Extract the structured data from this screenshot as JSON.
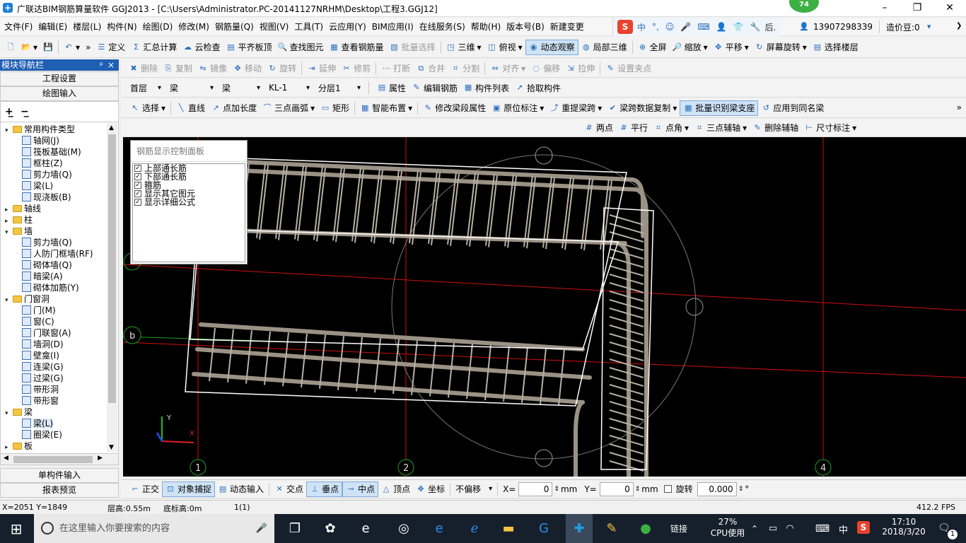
{
  "title_bar": {
    "title": "广联达BIM钢筋算量软件 GGJ2013 - [C:\\Users\\Administrator.PC-20141127NRHM\\Desktop\\工程3.GGJ12]",
    "badge": "74",
    "min": "–",
    "restore": "❐",
    "close": "✕"
  },
  "menu": {
    "items": [
      "文件(F)",
      "编辑(E)",
      "楼层(L)",
      "构件(N)",
      "绘图(D)",
      "修改(M)",
      "钢筋量(Q)",
      "视图(V)",
      "工具(T)",
      "云应用(Y)",
      "BIM应用(I)",
      "在线服务(S)",
      "帮助(H)",
      "版本号(B)",
      "新建变更"
    ],
    "ime": [
      "中",
      "°,",
      "☺",
      "🎤",
      "⌨",
      "👤",
      "👕",
      "🔧"
    ],
    "phone": "13907298339",
    "price": "造价豆:0"
  },
  "toolbar1": {
    "items": [
      "定义",
      "汇总计算",
      "云检查",
      "平齐板顶",
      "查找图元",
      "查看钢筋量",
      "批量选择",
      "三维",
      "俯视",
      "动态观察",
      "局部三维",
      "全屏",
      "缩放",
      "平移",
      "屏幕旋转",
      "选择楼层"
    ]
  },
  "toolbar2": {
    "items": [
      "删除",
      "复制",
      "镜像",
      "移动",
      "旋转",
      "延伸",
      "修剪",
      "打断",
      "合并",
      "分割",
      "对齐",
      "偏移",
      "拉伸",
      "设置夹点"
    ]
  },
  "toolbar3": {
    "floor": "首层",
    "type1": "梁",
    "type2": "梁",
    "comp": "KL-1",
    "layer": "分层1",
    "items": [
      "属性",
      "编辑钢筋",
      "构件列表",
      "拾取构件"
    ]
  },
  "toolbar4": {
    "items": [
      "选择",
      "直线",
      "点加长度",
      "三点画弧",
      "矩形",
      "智能布置",
      "修改梁段属性",
      "原位标注",
      "重提梁跨",
      "梁跨数据复制",
      "批量识别梁支座",
      "应用到同名梁"
    ]
  },
  "toolbar5": {
    "items": [
      "两点",
      "平行",
      "点角",
      "三点辅轴",
      "删除辅轴",
      "尺寸标注"
    ]
  },
  "nav": {
    "title": "模块导航栏",
    "pin": "ᵖ",
    "close": "×",
    "btn_project": "工程设置",
    "btn_draw": "绘图输入",
    "btn_single": "单构件输入",
    "btn_report": "报表预览",
    "tree": [
      {
        "label": "常用构件类型",
        "level": 0,
        "exp": "▾",
        "kind": "folder"
      },
      {
        "label": "轴网(J)",
        "level": 1,
        "kind": "item"
      },
      {
        "label": "筏板基础(M)",
        "level": 1,
        "kind": "item"
      },
      {
        "label": "框柱(Z)",
        "level": 1,
        "kind": "item"
      },
      {
        "label": "剪力墙(Q)",
        "level": 1,
        "kind": "item"
      },
      {
        "label": "梁(L)",
        "level": 1,
        "kind": "item"
      },
      {
        "label": "现浇板(B)",
        "level": 1,
        "kind": "item"
      },
      {
        "label": "轴线",
        "level": 0,
        "exp": "▸",
        "kind": "folder"
      },
      {
        "label": "柱",
        "level": 0,
        "exp": "▸",
        "kind": "folder"
      },
      {
        "label": "墙",
        "level": 0,
        "exp": "▾",
        "kind": "folder"
      },
      {
        "label": "剪力墙(Q)",
        "level": 1,
        "kind": "item"
      },
      {
        "label": "人防门框墙(RF)",
        "level": 1,
        "kind": "item"
      },
      {
        "label": "砌体墙(Q)",
        "level": 1,
        "kind": "item"
      },
      {
        "label": "暗梁(A)",
        "level": 1,
        "kind": "item"
      },
      {
        "label": "砌体加筋(Y)",
        "level": 1,
        "kind": "item"
      },
      {
        "label": "门窗洞",
        "level": 0,
        "exp": "▾",
        "kind": "folder"
      },
      {
        "label": "门(M)",
        "level": 1,
        "kind": "item"
      },
      {
        "label": "窗(C)",
        "level": 1,
        "kind": "item"
      },
      {
        "label": "门联窗(A)",
        "level": 1,
        "kind": "item"
      },
      {
        "label": "墙洞(D)",
        "level": 1,
        "kind": "item"
      },
      {
        "label": "壁龛(I)",
        "level": 1,
        "kind": "item"
      },
      {
        "label": "连梁(G)",
        "level": 1,
        "kind": "item"
      },
      {
        "label": "过梁(G)",
        "level": 1,
        "kind": "item"
      },
      {
        "label": "带形洞",
        "level": 1,
        "kind": "item"
      },
      {
        "label": "带形窗",
        "level": 1,
        "kind": "item"
      },
      {
        "label": "梁",
        "level": 0,
        "exp": "▾",
        "kind": "folder"
      },
      {
        "label": "梁(L)",
        "level": 1,
        "kind": "item",
        "selected": true
      },
      {
        "label": "圈梁(E)",
        "level": 1,
        "kind": "item"
      },
      {
        "label": "板",
        "level": 0,
        "exp": "▸",
        "kind": "folder"
      }
    ]
  },
  "panel": {
    "title": "钢筋显示控制面板",
    "options": [
      "上部通长筋",
      "下部通长筋",
      "箍筋",
      "显示其它图元",
      "显示详细公式"
    ]
  },
  "viewport": {
    "axes": [
      "1",
      "2",
      "4"
    ],
    "axis_b": "b",
    "axis_x": "X",
    "axis_y": "Y"
  },
  "snapbar": {
    "items": [
      "正交",
      "对象捕捉",
      "动态输入",
      "交点",
      "垂点",
      "中点",
      "顶点",
      "坐标"
    ],
    "offset": "不偏移",
    "x_label": "X=",
    "x_value": "0",
    "y_label": "Y=",
    "y_value": "0",
    "unit": "mm",
    "rotate_label": "旋转",
    "rotate_value": "0.000",
    "deg": "°"
  },
  "status": {
    "coords": "X=2051 Y=1849",
    "floor_height": "层高:0.55m",
    "base_height": "底标高:0m",
    "page": "1(1)",
    "fps": "412.2 FPS"
  },
  "taskbar": {
    "search": "在这里输入你要搜索的内容",
    "link": "链接",
    "cpu_pct": "27%",
    "cpu_label": "CPU使用",
    "lang": "中",
    "time": "17:10",
    "date": "2018/3/20",
    "notif": "1"
  }
}
